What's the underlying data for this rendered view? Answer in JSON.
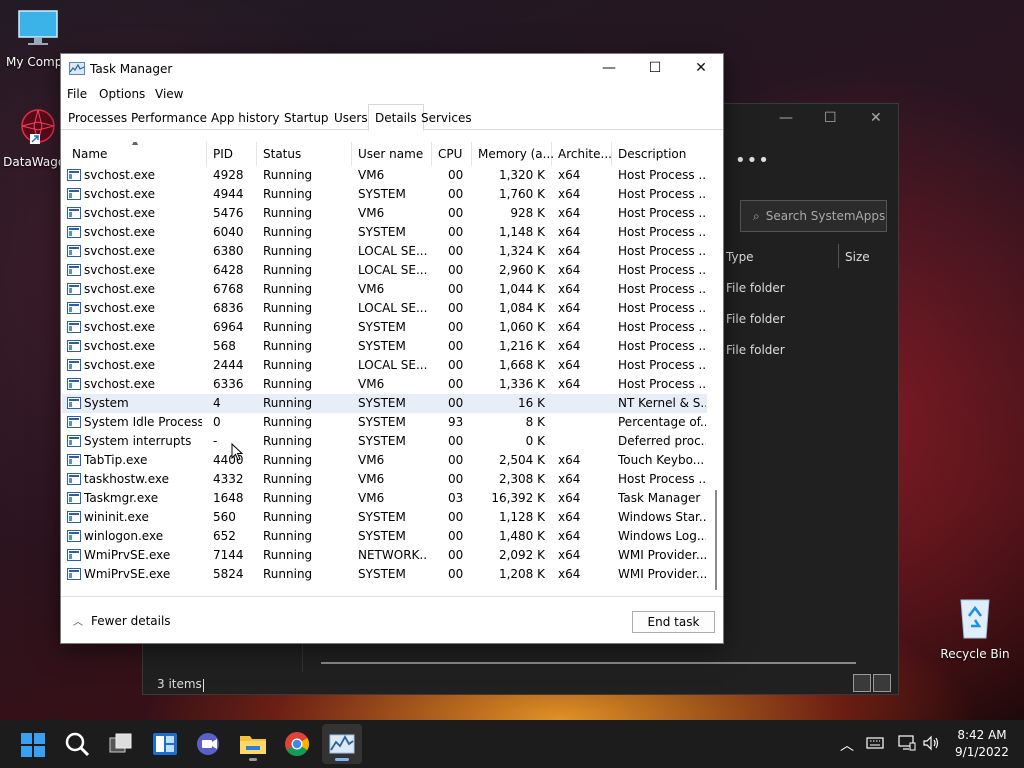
{
  "desktop": {
    "icons": [
      {
        "label": "My Compu"
      },
      {
        "label": "DataWagon"
      },
      {
        "label": "Recycle Bin"
      }
    ]
  },
  "explorer": {
    "more": "•••",
    "search_placeholder": "Search SystemApps",
    "col_type": "Type",
    "col_size": "Size",
    "folders": [
      "File folder",
      "File folder",
      "File folder"
    ],
    "status": "3 items"
  },
  "taskmanager": {
    "title": "Task Manager",
    "window_buttons": {
      "minimize": "—",
      "maximize": "☐",
      "close": "✕"
    },
    "menu": [
      "File",
      "Options",
      "View"
    ],
    "tabs": [
      "Processes",
      "Performance",
      "App history",
      "Startup",
      "Users",
      "Details",
      "Services"
    ],
    "active_tab": "Details",
    "columns": [
      "Name",
      "PID",
      "Status",
      "User name",
      "CPU",
      "Memory (a...",
      "Archite...",
      "Description"
    ],
    "rows": [
      {
        "name": "svchost.exe",
        "pid": "4928",
        "status": "Running",
        "user": "VM6",
        "cpu": "00",
        "mem": "1,320 K",
        "arch": "x64",
        "desc": "Host Process ..."
      },
      {
        "name": "svchost.exe",
        "pid": "4944",
        "status": "Running",
        "user": "SYSTEM",
        "cpu": "00",
        "mem": "1,760 K",
        "arch": "x64",
        "desc": "Host Process ..."
      },
      {
        "name": "svchost.exe",
        "pid": "5476",
        "status": "Running",
        "user": "VM6",
        "cpu": "00",
        "mem": "928 K",
        "arch": "x64",
        "desc": "Host Process ..."
      },
      {
        "name": "svchost.exe",
        "pid": "6040",
        "status": "Running",
        "user": "SYSTEM",
        "cpu": "00",
        "mem": "1,148 K",
        "arch": "x64",
        "desc": "Host Process ..."
      },
      {
        "name": "svchost.exe",
        "pid": "6380",
        "status": "Running",
        "user": "LOCAL SE...",
        "cpu": "00",
        "mem": "1,324 K",
        "arch": "x64",
        "desc": "Host Process ..."
      },
      {
        "name": "svchost.exe",
        "pid": "6428",
        "status": "Running",
        "user": "LOCAL SE...",
        "cpu": "00",
        "mem": "2,960 K",
        "arch": "x64",
        "desc": "Host Process ..."
      },
      {
        "name": "svchost.exe",
        "pid": "6768",
        "status": "Running",
        "user": "VM6",
        "cpu": "00",
        "mem": "1,044 K",
        "arch": "x64",
        "desc": "Host Process ..."
      },
      {
        "name": "svchost.exe",
        "pid": "6836",
        "status": "Running",
        "user": "LOCAL SE...",
        "cpu": "00",
        "mem": "1,084 K",
        "arch": "x64",
        "desc": "Host Process ..."
      },
      {
        "name": "svchost.exe",
        "pid": "6964",
        "status": "Running",
        "user": "SYSTEM",
        "cpu": "00",
        "mem": "1,060 K",
        "arch": "x64",
        "desc": "Host Process ..."
      },
      {
        "name": "svchost.exe",
        "pid": "568",
        "status": "Running",
        "user": "SYSTEM",
        "cpu": "00",
        "mem": "1,216 K",
        "arch": "x64",
        "desc": "Host Process ..."
      },
      {
        "name": "svchost.exe",
        "pid": "2444",
        "status": "Running",
        "user": "LOCAL SE...",
        "cpu": "00",
        "mem": "1,668 K",
        "arch": "x64",
        "desc": "Host Process ..."
      },
      {
        "name": "svchost.exe",
        "pid": "6336",
        "status": "Running",
        "user": "VM6",
        "cpu": "00",
        "mem": "1,336 K",
        "arch": "x64",
        "desc": "Host Process ..."
      },
      {
        "name": "System",
        "pid": "4",
        "status": "Running",
        "user": "SYSTEM",
        "cpu": "00",
        "mem": "16 K",
        "arch": "",
        "desc": "NT Kernel & S...",
        "highlight": true
      },
      {
        "name": "System Idle Process",
        "pid": "0",
        "status": "Running",
        "user": "SYSTEM",
        "cpu": "93",
        "mem": "8 K",
        "arch": "",
        "desc": "Percentage of..."
      },
      {
        "name": "System interrupts",
        "pid": "-",
        "status": "Running",
        "user": "SYSTEM",
        "cpu": "00",
        "mem": "0 K",
        "arch": "",
        "desc": "Deferred proc..."
      },
      {
        "name": "TabTip.exe",
        "pid": "4400",
        "status": "Running",
        "user": "VM6",
        "cpu": "00",
        "mem": "2,504 K",
        "arch": "x64",
        "desc": "Touch Keybo..."
      },
      {
        "name": "taskhostw.exe",
        "pid": "4332",
        "status": "Running",
        "user": "VM6",
        "cpu": "00",
        "mem": "2,308 K",
        "arch": "x64",
        "desc": "Host Process ..."
      },
      {
        "name": "Taskmgr.exe",
        "pid": "1648",
        "status": "Running",
        "user": "VM6",
        "cpu": "03",
        "mem": "16,392 K",
        "arch": "x64",
        "desc": "Task Manager"
      },
      {
        "name": "wininit.exe",
        "pid": "560",
        "status": "Running",
        "user": "SYSTEM",
        "cpu": "00",
        "mem": "1,128 K",
        "arch": "x64",
        "desc": "Windows Star..."
      },
      {
        "name": "winlogon.exe",
        "pid": "652",
        "status": "Running",
        "user": "SYSTEM",
        "cpu": "00",
        "mem": "1,480 K",
        "arch": "x64",
        "desc": "Windows Log..."
      },
      {
        "name": "WmiPrvSE.exe",
        "pid": "7144",
        "status": "Running",
        "user": "NETWORK...",
        "cpu": "00",
        "mem": "2,092 K",
        "arch": "x64",
        "desc": "WMI Provider..."
      },
      {
        "name": "WmiPrvSE.exe",
        "pid": "5824",
        "status": "Running",
        "user": "SYSTEM",
        "cpu": "00",
        "mem": "1,208 K",
        "arch": "x64",
        "desc": "WMI Provider..."
      }
    ],
    "fewer_details": "Fewer details",
    "end_task": "End task"
  },
  "taskbar": {
    "time": "8:42 AM",
    "date": "9/1/2022"
  },
  "colors": {
    "accent": "#0067c0",
    "highlight_row": "#e8eef7"
  }
}
